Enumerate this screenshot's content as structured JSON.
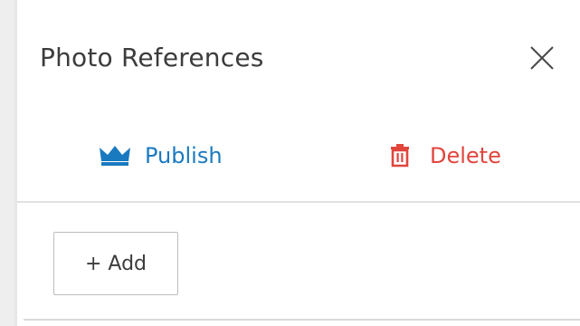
{
  "panel": {
    "title": "Photo References",
    "close_icon": "close-icon"
  },
  "toolbar": {
    "publish_label": "Publish",
    "publish_icon": "crown-icon",
    "delete_label": "Delete",
    "delete_icon": "trash-icon"
  },
  "actions": {
    "add_label": "+ Add"
  },
  "colors": {
    "publish": "#1a7ac0",
    "delete": "#e1453c",
    "text": "#3c3c3c",
    "border": "#bdbdbd"
  }
}
